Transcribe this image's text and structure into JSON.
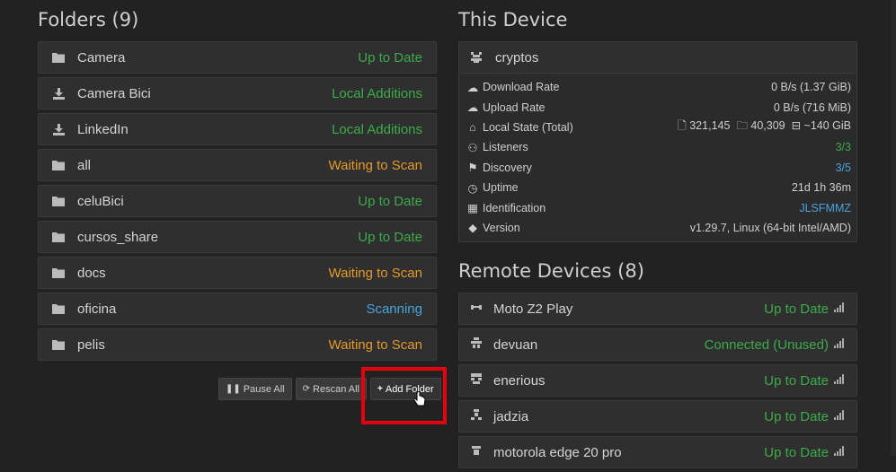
{
  "folders": {
    "title": "Folders (9)",
    "items": [
      {
        "name": "Camera",
        "status": "Up to Date",
        "status_color": "green",
        "icon": "folder-icon"
      },
      {
        "name": "Camera Bici",
        "status": "Local Additions",
        "status_color": "green",
        "icon": "download-icon"
      },
      {
        "name": "LinkedIn",
        "status": "Local Additions",
        "status_color": "green",
        "icon": "download-icon"
      },
      {
        "name": "all",
        "status": "Waiting to Scan",
        "status_color": "orange",
        "icon": "folder-icon"
      },
      {
        "name": "celuBici",
        "status": "Up to Date",
        "status_color": "green",
        "icon": "folder-icon"
      },
      {
        "name": "cursos_share",
        "status": "Up to Date",
        "status_color": "green",
        "icon": "folder-icon"
      },
      {
        "name": "docs",
        "status": "Waiting to Scan",
        "status_color": "orange",
        "icon": "folder-icon"
      },
      {
        "name": "oficina",
        "status": "Scanning",
        "status_color": "blue",
        "icon": "folder-icon"
      },
      {
        "name": "pelis",
        "status": "Waiting to Scan",
        "status_color": "orange",
        "icon": "folder-icon"
      }
    ],
    "buttons": {
      "pause_all": "Pause All",
      "rescan_all": "Rescan All",
      "add_folder": "Add Folder"
    }
  },
  "this_device": {
    "title": "This Device",
    "name": "cryptos",
    "stats": {
      "download_rate": {
        "label": "Download Rate",
        "value": "0 B/s (1.37 GiB)"
      },
      "upload_rate": {
        "label": "Upload Rate",
        "value": "0 B/s (716 MiB)"
      },
      "local_state": {
        "label": "Local State (Total)",
        "files": "321,145",
        "folders": "40,309",
        "size": "~140 GiB"
      },
      "listeners": {
        "label": "Listeners",
        "value": "3/3"
      },
      "discovery": {
        "label": "Discovery",
        "value": "3/5"
      },
      "uptime": {
        "label": "Uptime",
        "value": "21d 1h 36m"
      },
      "identification": {
        "label": "Identification",
        "value": "JLSFMMZ"
      },
      "version": {
        "label": "Version",
        "value": "v1.29.7, Linux (64-bit Intel/AMD)"
      }
    }
  },
  "remote_devices": {
    "title": "Remote Devices (8)",
    "items": [
      {
        "name": "Moto Z2 Play",
        "status": "Up to Date"
      },
      {
        "name": "devuan",
        "status": "Connected (Unused)"
      },
      {
        "name": "enerious",
        "status": "Up to Date"
      },
      {
        "name": "jadzia",
        "status": "Up to Date"
      },
      {
        "name": "motorola edge 20 pro",
        "status": "Up to Date"
      }
    ]
  },
  "colors": {
    "green": "#3cab4b",
    "orange": "#e39a2b",
    "blue": "#4aa3df",
    "highlight": "#e4000f"
  }
}
